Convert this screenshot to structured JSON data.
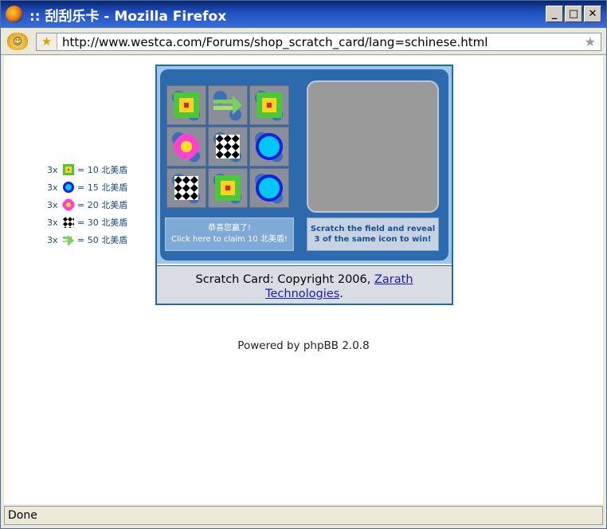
{
  "window": {
    "title": ":: 刮刮乐卡 - Mozilla Firefox",
    "controls": {
      "minimize": "_",
      "maximize": "□",
      "close": "✕"
    }
  },
  "navbar": {
    "url": "http://www.westca.com/Forums/shop_scratch_card/lang=schinese.html"
  },
  "legend": [
    {
      "multiplier": "3x",
      "icon": "square-icon",
      "reward": "= 10 北美盾"
    },
    {
      "multiplier": "3x",
      "icon": "ring-icon",
      "reward": "= 15 北美盾"
    },
    {
      "multiplier": "3x",
      "icon": "flower-icon",
      "reward": "= 20 北美盾"
    },
    {
      "multiplier": "3x",
      "icon": "checker-icon",
      "reward": "= 30 北美盾"
    },
    {
      "multiplier": "3x",
      "icon": "arrow-icon",
      "reward": "= 50 北美盾"
    }
  ],
  "card": {
    "grid_icons": [
      "square-icon",
      "arrow-icon",
      "square-icon",
      "flower-icon",
      "checker-icon",
      "ring-icon",
      "checker-icon",
      "square-icon",
      "ring-icon"
    ],
    "win_line1": "恭喜您赢了!",
    "win_line2": "Click here to claim 10 北美盾!",
    "instructions_line1": "Scratch the field and reveal",
    "instructions_line2": "3 of the same icon to win!",
    "footer_prefix": "Scratch Card: Copyright 2006,",
    "footer_link": "Zarath Technologies",
    "footer_suffix": "."
  },
  "powered_by": "Powered by phpBB 2.0.8",
  "status": "Done",
  "colors": {
    "title_bar": "#0a246a",
    "link": "#1a1ab0",
    "legend_text": "#1c4a82"
  }
}
